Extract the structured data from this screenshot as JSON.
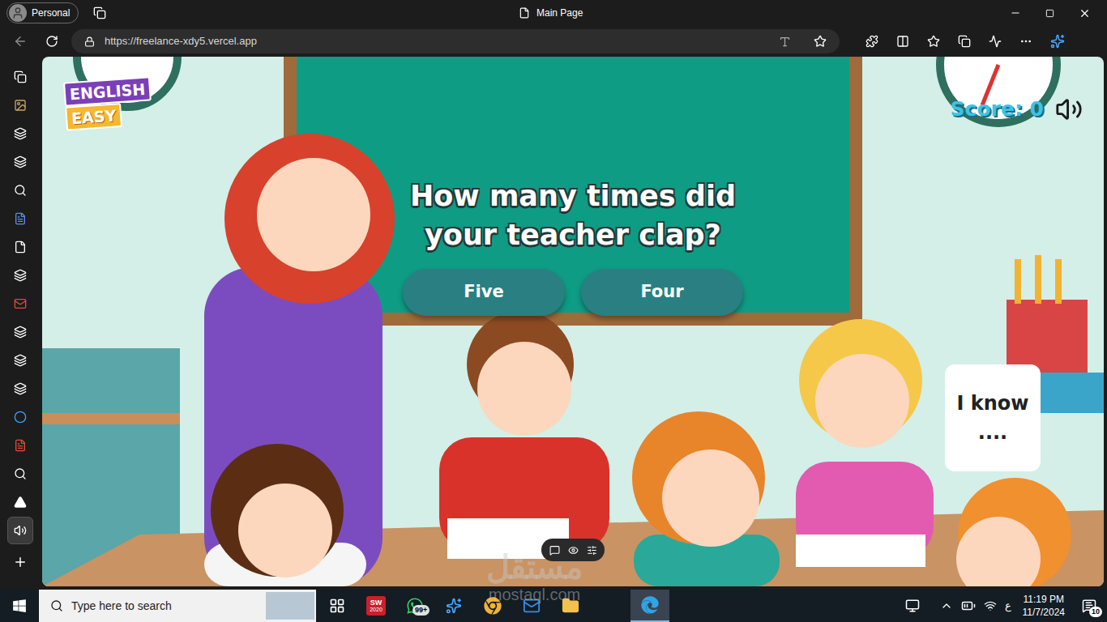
{
  "window": {
    "title": "Main Page",
    "profile": "Personal"
  },
  "address_bar": {
    "url": "https://freelance-xdy5.vercel.app"
  },
  "sidebar": {
    "items": [
      {
        "kind": "tabs",
        "selected": false
      },
      {
        "kind": "image",
        "selected": false
      },
      {
        "kind": "page",
        "selected": false
      },
      {
        "kind": "page",
        "selected": false
      },
      {
        "kind": "search",
        "selected": false
      },
      {
        "kind": "doc",
        "selected": false
      },
      {
        "kind": "file",
        "selected": false
      },
      {
        "kind": "page",
        "selected": false
      },
      {
        "kind": "gmail",
        "selected": false
      },
      {
        "kind": "page",
        "selected": false
      },
      {
        "kind": "page",
        "selected": false
      },
      {
        "kind": "page",
        "selected": false
      },
      {
        "kind": "circle",
        "selected": false
      },
      {
        "kind": "pdf",
        "selected": false
      },
      {
        "kind": "search",
        "selected": false
      },
      {
        "kind": "triangle",
        "selected": false
      },
      {
        "kind": "speaker",
        "selected": true
      }
    ]
  },
  "game": {
    "logo": [
      "ENGLISH",
      "EASY"
    ],
    "score": "Score: 0",
    "question": "How many times did your teacher clap?",
    "answers": [
      {
        "label": "Five"
      },
      {
        "label": "Four"
      }
    ],
    "speech_bubble": "I know ....",
    "muted": false
  },
  "watermark": {
    "arabic": "مستقل",
    "latin": "mostaql.com"
  },
  "taskbar": {
    "search_placeholder": "Type here to search",
    "apps": [
      {
        "kind": "task-view",
        "selected": false,
        "label": "",
        "badge": ""
      },
      {
        "kind": "solidworks",
        "selected": false,
        "label": "SW",
        "badge": "2020"
      },
      {
        "kind": "whatsapp",
        "selected": false,
        "label": "",
        "badge": "99+"
      },
      {
        "kind": "copilot",
        "selected": false,
        "label": "",
        "badge": ""
      },
      {
        "kind": "chrome",
        "selected": false,
        "label": "",
        "badge": ""
      },
      {
        "kind": "mail",
        "selected": false,
        "label": "",
        "badge": ""
      },
      {
        "kind": "explorer",
        "selected": false,
        "label": "",
        "badge": ""
      },
      {
        "kind": "edge",
        "selected": true,
        "label": "",
        "badge": ""
      }
    ],
    "language": "ع",
    "time": "11:19 PM",
    "date": "11/7/2024",
    "notifications": "10"
  }
}
